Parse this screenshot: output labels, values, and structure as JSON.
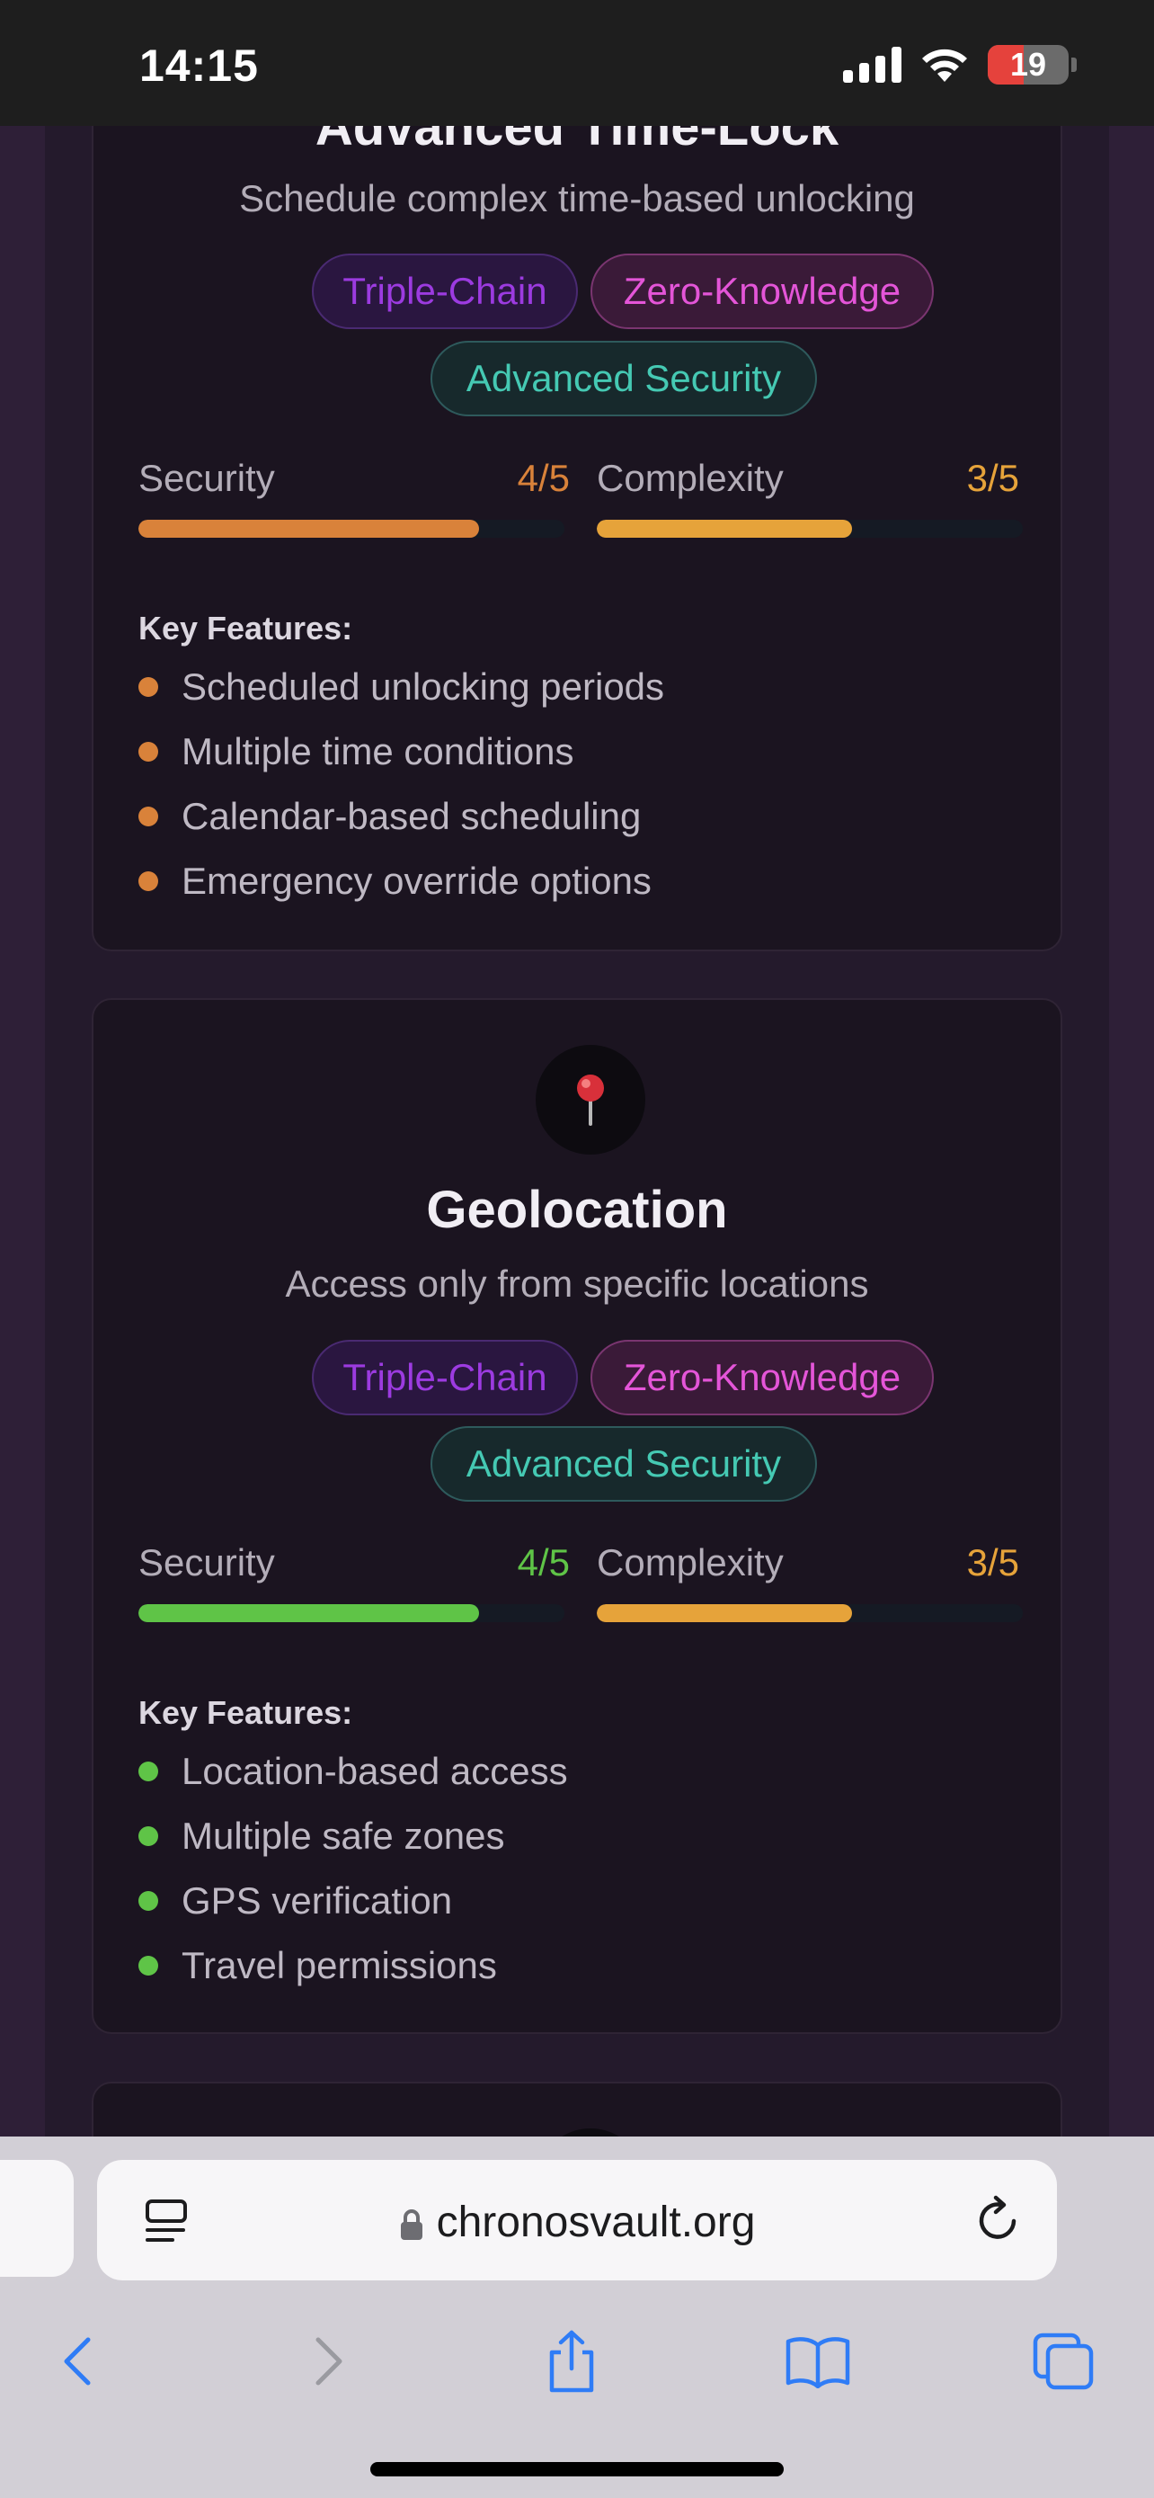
{
  "status": {
    "time": "14:15",
    "battery": "19"
  },
  "cards": [
    {
      "title": "Advanced Time-Lock",
      "subtitle": "Schedule complex time-based unlocking",
      "tags": [
        "Triple-Chain",
        "Zero-Knowledge",
        "Advanced Security"
      ],
      "security": {
        "label": "Security",
        "value": "4/5",
        "level": 0.8,
        "color": "#d9823a"
      },
      "complexity": {
        "label": "Complexity",
        "value": "3/5",
        "level": 0.6,
        "color": "#e6a33a"
      },
      "features_title": "Key Features:",
      "feature_color": "#d9823a",
      "features": [
        "Scheduled unlocking periods",
        "Multiple time conditions",
        "Calendar-based scheduling",
        "Emergency override options"
      ]
    },
    {
      "icon": "pushpin-icon",
      "title": "Geolocation",
      "subtitle": "Access only from specific locations",
      "tags": [
        "Triple-Chain",
        "Zero-Knowledge",
        "Advanced Security"
      ],
      "security": {
        "label": "Security",
        "value": "4/5",
        "level": 0.8,
        "color": "#5fc447"
      },
      "complexity": {
        "label": "Complexity",
        "value": "3/5",
        "level": 0.6,
        "color": "#e6a33a"
      },
      "features_title": "Key Features:",
      "feature_color": "#5fc447",
      "features": [
        "Location-based access",
        "Multiple safe zones",
        "GPS verification",
        "Travel permissions"
      ]
    }
  ],
  "browser": {
    "url": "chronosvault.org"
  }
}
